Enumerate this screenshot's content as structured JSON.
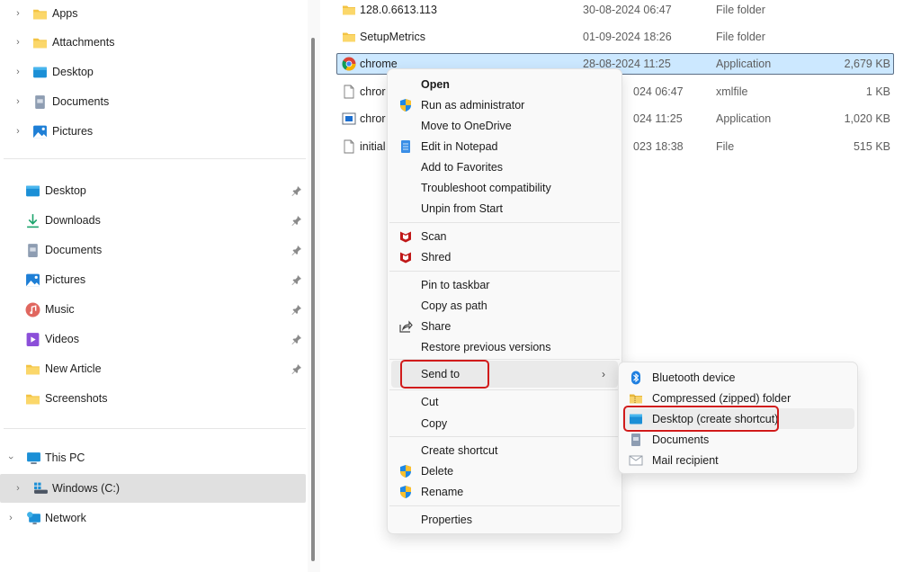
{
  "nav": {
    "tree_top": [
      {
        "label": "Apps",
        "icon": "folder-icon"
      },
      {
        "label": "Attachments",
        "icon": "folder-icon"
      },
      {
        "label": "Desktop",
        "icon": "desktop-icon"
      },
      {
        "label": "Documents",
        "icon": "documents-icon"
      },
      {
        "label": "Pictures",
        "icon": "pictures-icon"
      }
    ],
    "quick_access": [
      {
        "label": "Desktop",
        "icon": "desktop-icon",
        "pinned": true
      },
      {
        "label": "Downloads",
        "icon": "downloads-icon",
        "pinned": true
      },
      {
        "label": "Documents",
        "icon": "documents-icon",
        "pinned": true
      },
      {
        "label": "Pictures",
        "icon": "pictures-icon",
        "pinned": true
      },
      {
        "label": "Music",
        "icon": "music-icon",
        "pinned": true
      },
      {
        "label": "Videos",
        "icon": "videos-icon",
        "pinned": true
      },
      {
        "label": "New Article",
        "icon": "folder-icon",
        "pinned": true
      },
      {
        "label": "Screenshots",
        "icon": "folder-icon",
        "pinned": false
      }
    ],
    "this_pc": {
      "label": "This PC",
      "icon": "this-pc-icon",
      "expanded": true
    },
    "windows_c": {
      "label": "Windows (C:)",
      "icon": "drive-icon",
      "selected": true
    },
    "network": {
      "label": "Network",
      "icon": "network-icon"
    }
  },
  "files": [
    {
      "name": "128.0.6613.113",
      "date": "30-08-2024 06:47",
      "type": "File folder",
      "size": "",
      "icon": "folder-icon"
    },
    {
      "name": "SetupMetrics",
      "date": "01-09-2024 18:26",
      "type": "File folder",
      "size": "",
      "icon": "folder-icon"
    },
    {
      "name": "chrome",
      "date": "28-08-2024 11:25",
      "type": "Application",
      "size": "2,679 KB",
      "icon": "chrome-icon",
      "selected": true
    },
    {
      "name": "chror",
      "date": "024 06:47",
      "type": "xmlfile",
      "size": "1 KB",
      "icon": "file-icon"
    },
    {
      "name": "chror",
      "date": "024 11:25",
      "type": "Application",
      "size": "1,020 KB",
      "icon": "app-window-icon"
    },
    {
      "name": "initial",
      "date": "023 18:38",
      "type": "File",
      "size": "515 KB",
      "icon": "file-icon"
    }
  ],
  "context_menu": {
    "open": "Open",
    "run_as_admin": "Run as administrator",
    "move_to_onedrive": "Move to OneDrive",
    "edit_in_notepad": "Edit in Notepad",
    "add_to_favorites": "Add to Favorites",
    "troubleshoot": "Troubleshoot compatibility",
    "unpin_from_start": "Unpin from Start",
    "scan": "Scan",
    "shred": "Shred",
    "pin_to_taskbar": "Pin to taskbar",
    "copy_as_path": "Copy as path",
    "share": "Share",
    "restore_previous": "Restore previous versions",
    "send_to": "Send to",
    "cut": "Cut",
    "copy": "Copy",
    "create_shortcut": "Create shortcut",
    "delete": "Delete",
    "rename": "Rename",
    "properties": "Properties"
  },
  "send_to_menu": {
    "items": [
      {
        "label": "Bluetooth device",
        "icon": "bluetooth-icon"
      },
      {
        "label": "Compressed (zipped) folder",
        "icon": "zip-folder-icon"
      },
      {
        "label": "Desktop (create shortcut)",
        "icon": "desktop-icon",
        "highlighted": true
      },
      {
        "label": "Documents",
        "icon": "documents-icon"
      },
      {
        "label": "Mail recipient",
        "icon": "mail-icon"
      }
    ]
  },
  "colors": {
    "selection_bg": "#cce8ff",
    "highlight_border": "#d11b1b",
    "folder_yellow": "#f7c948"
  }
}
